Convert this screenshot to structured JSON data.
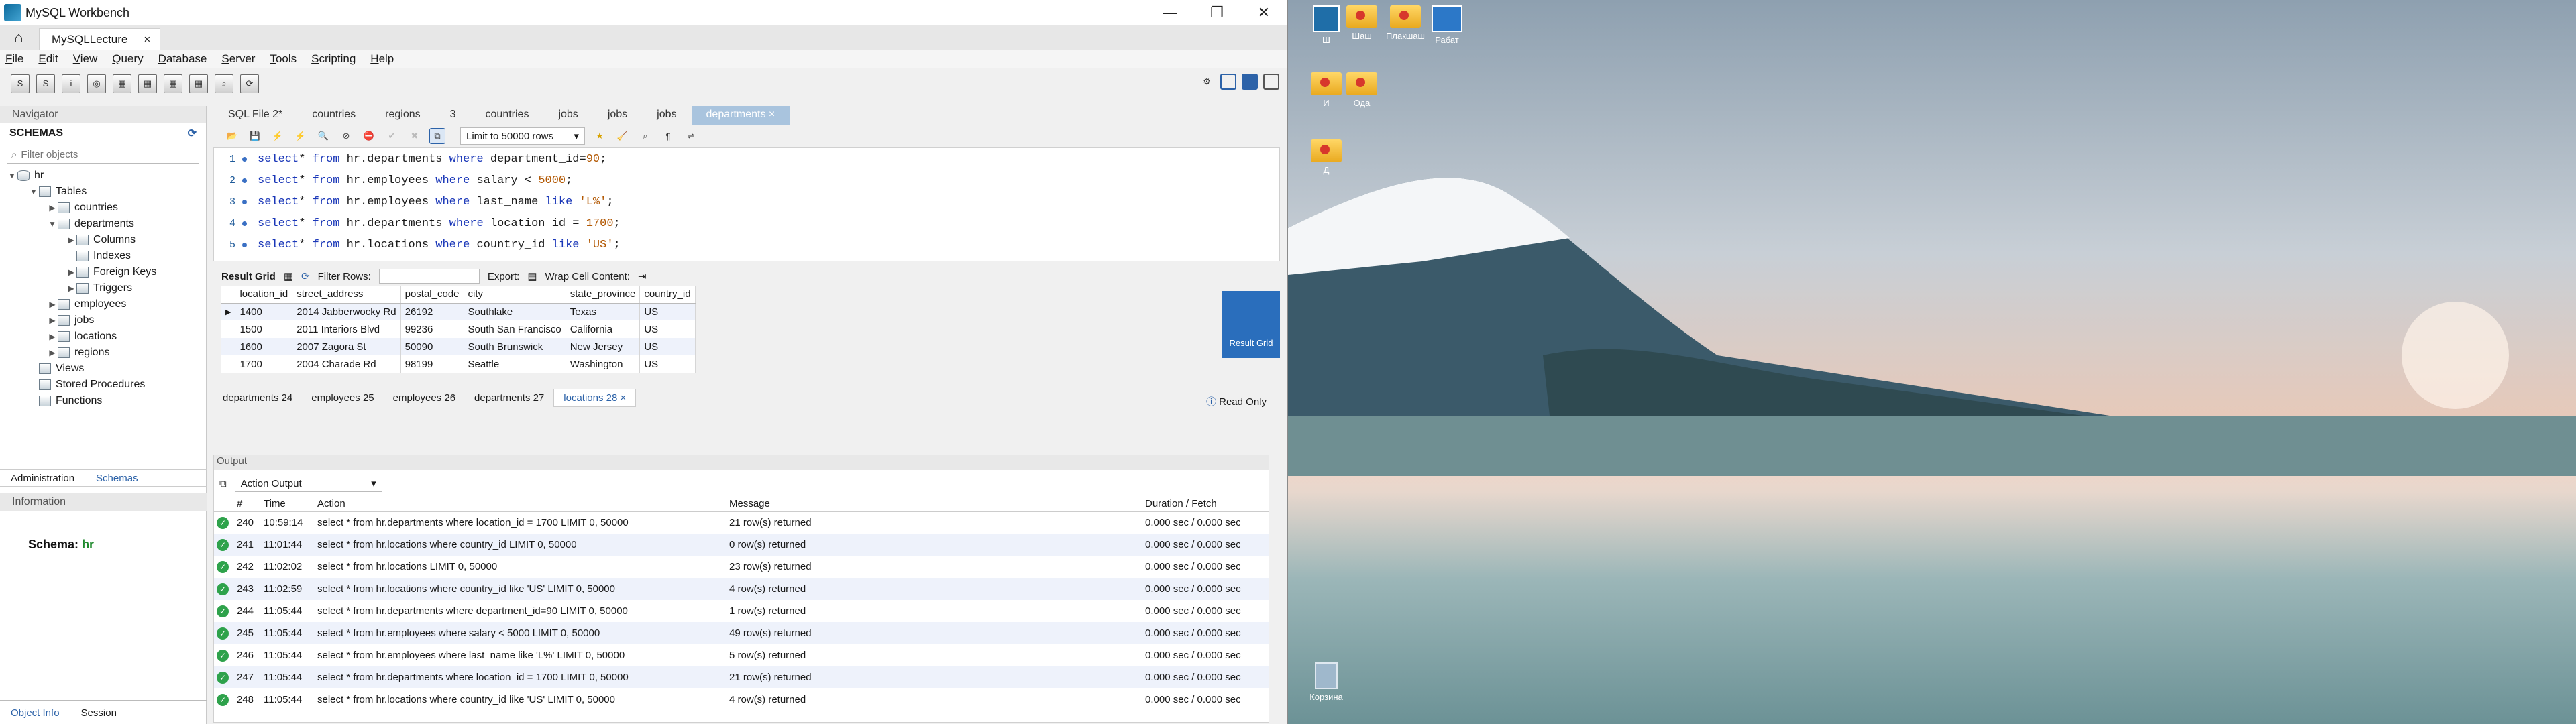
{
  "window": {
    "title": "MySQL Workbench",
    "minimize": "—",
    "restore": "❐",
    "close": "✕"
  },
  "connection_tab": {
    "label": "MySQLLecture",
    "close": "×"
  },
  "menu": [
    "File",
    "Edit",
    "View",
    "Query",
    "Database",
    "Server",
    "Tools",
    "Scripting",
    "Help"
  ],
  "navigator": {
    "title": "Navigator",
    "schemas_title": "SCHEMAS",
    "filter_placeholder": "Filter objects",
    "tree": {
      "schema": "hr",
      "tables_folder": "Tables",
      "tables": [
        "countries",
        "departments",
        "employees",
        "jobs",
        "locations",
        "regions"
      ],
      "departments_children": [
        "Columns",
        "Indexes",
        "Foreign Keys",
        "Triggers"
      ],
      "views": "Views",
      "procedures": "Stored Procedures",
      "functions": "Functions"
    },
    "tabs": [
      "Administration",
      "Schemas"
    ],
    "info_title": "Information",
    "schema_label": "Schema:",
    "schema_value": "hr",
    "bottom_tabs": [
      "Object Info",
      "Session"
    ]
  },
  "file_tabs": [
    "SQL File 2*",
    "countries",
    "regions",
    "3",
    "countries",
    "jobs",
    "jobs",
    "jobs",
    "departments"
  ],
  "editor": {
    "limit_label": "Limit to 50000 rows",
    "lines": [
      {
        "num": "1",
        "parts": [
          [
            "kw",
            "select"
          ],
          [
            "",
            "* "
          ],
          [
            "kw",
            "from"
          ],
          [
            "",
            " hr.departments "
          ],
          [
            "kw",
            "where"
          ],
          [
            "",
            " department_id="
          ],
          [
            "st",
            "90"
          ],
          [
            "",
            ";"
          ]
        ]
      },
      {
        "num": "2",
        "parts": [
          [
            "kw",
            "select"
          ],
          [
            "",
            "* "
          ],
          [
            "kw",
            "from"
          ],
          [
            "",
            " hr.employees "
          ],
          [
            "kw",
            "where"
          ],
          [
            "",
            " salary < "
          ],
          [
            "st",
            "5000"
          ],
          [
            "",
            ";"
          ]
        ]
      },
      {
        "num": "3",
        "parts": [
          [
            "kw",
            "select"
          ],
          [
            "",
            "* "
          ],
          [
            "kw",
            "from"
          ],
          [
            "",
            " hr.employees "
          ],
          [
            "kw",
            "where"
          ],
          [
            "",
            " last_name "
          ],
          [
            "kw",
            "like"
          ],
          [
            "",
            " "
          ],
          [
            "st",
            "'L%'"
          ],
          [
            "",
            ";"
          ]
        ]
      },
      {
        "num": "4",
        "parts": [
          [
            "kw",
            "select"
          ],
          [
            "",
            "* "
          ],
          [
            "kw",
            "from"
          ],
          [
            "",
            " hr.departments "
          ],
          [
            "kw",
            "where"
          ],
          [
            "",
            " location_id = "
          ],
          [
            "st",
            "1700"
          ],
          [
            "",
            ";"
          ]
        ]
      },
      {
        "num": "5",
        "parts": [
          [
            "kw",
            "select"
          ],
          [
            "",
            "* "
          ],
          [
            "kw",
            "from"
          ],
          [
            "",
            " hr.locations "
          ],
          [
            "kw",
            "where"
          ],
          [
            "",
            " country_id "
          ],
          [
            "kw",
            "like"
          ],
          [
            "",
            " "
          ],
          [
            "st",
            "'US'"
          ],
          [
            "",
            ";"
          ]
        ]
      }
    ]
  },
  "result": {
    "label": "Result Grid",
    "filter_label": "Filter Rows:",
    "export_label": "Export:",
    "wrap_label": "Wrap Cell Content:",
    "side_label": "Result Grid",
    "columns": [
      "location_id",
      "street_address",
      "postal_code",
      "city",
      "state_province",
      "country_id"
    ],
    "rows": [
      [
        "1400",
        "2014 Jabberwocky Rd",
        "26192",
        "Southlake",
        "Texas",
        "US"
      ],
      [
        "1500",
        "2011 Interiors Blvd",
        "99236",
        "South San Francisco",
        "California",
        "US"
      ],
      [
        "1600",
        "2007 Zagora St",
        "50090",
        "South Brunswick",
        "New Jersey",
        "US"
      ],
      [
        "1700",
        "2004 Charade Rd",
        "98199",
        "Seattle",
        "Washington",
        "US"
      ]
    ],
    "tabs": [
      "departments 24",
      "employees 25",
      "employees 26",
      "departments 27",
      "locations 28"
    ],
    "read_only": "Read Only"
  },
  "output": {
    "title": "Output",
    "selector": "Action Output",
    "columns": [
      "#",
      "Time",
      "Action",
      "Message",
      "Duration / Fetch"
    ],
    "rows": [
      [
        "240",
        "10:59:14",
        "select * from hr.departments where location_id = 1700 LIMIT 0, 50000",
        "21 row(s) returned",
        "0.000 sec / 0.000 sec"
      ],
      [
        "241",
        "11:01:44",
        "select * from hr.locations where country_id LIMIT 0, 50000",
        "0 row(s) returned",
        "0.000 sec / 0.000 sec"
      ],
      [
        "242",
        "11:02:02",
        "select * from hr.locations LIMIT 0, 50000",
        "23 row(s) returned",
        "0.000 sec / 0.000 sec"
      ],
      [
        "243",
        "11:02:59",
        "select * from hr.locations where country_id like 'US' LIMIT 0, 50000",
        "4 row(s) returned",
        "0.000 sec / 0.000 sec"
      ],
      [
        "244",
        "11:05:44",
        "select * from hr.departments where department_id=90 LIMIT 0, 50000",
        "1 row(s) returned",
        "0.000 sec / 0.000 sec"
      ],
      [
        "245",
        "11:05:44",
        "select * from hr.employees where salary < 5000 LIMIT 0, 50000",
        "49 row(s) returned",
        "0.000 sec / 0.000 sec"
      ],
      [
        "246",
        "11:05:44",
        "select * from hr.employees where last_name like 'L%' LIMIT 0, 50000",
        "5 row(s) returned",
        "0.000 sec / 0.000 sec"
      ],
      [
        "247",
        "11:05:44",
        "select * from hr.departments where location_id = 1700 LIMIT 0, 50000",
        "21 row(s) returned",
        "0.000 sec / 0.000 sec"
      ],
      [
        "248",
        "11:05:44",
        "select * from hr.locations where country_id like 'US' LIMIT 0, 50000",
        "4 row(s) returned",
        "0.000 sec / 0.000 sec"
      ]
    ]
  },
  "desktop": {
    "icons": [
      "Ш",
      "Шаш",
      "Плакшаш",
      "Рабат",
      "И",
      "Ода",
      "Д"
    ],
    "recycle": "Корзина"
  }
}
